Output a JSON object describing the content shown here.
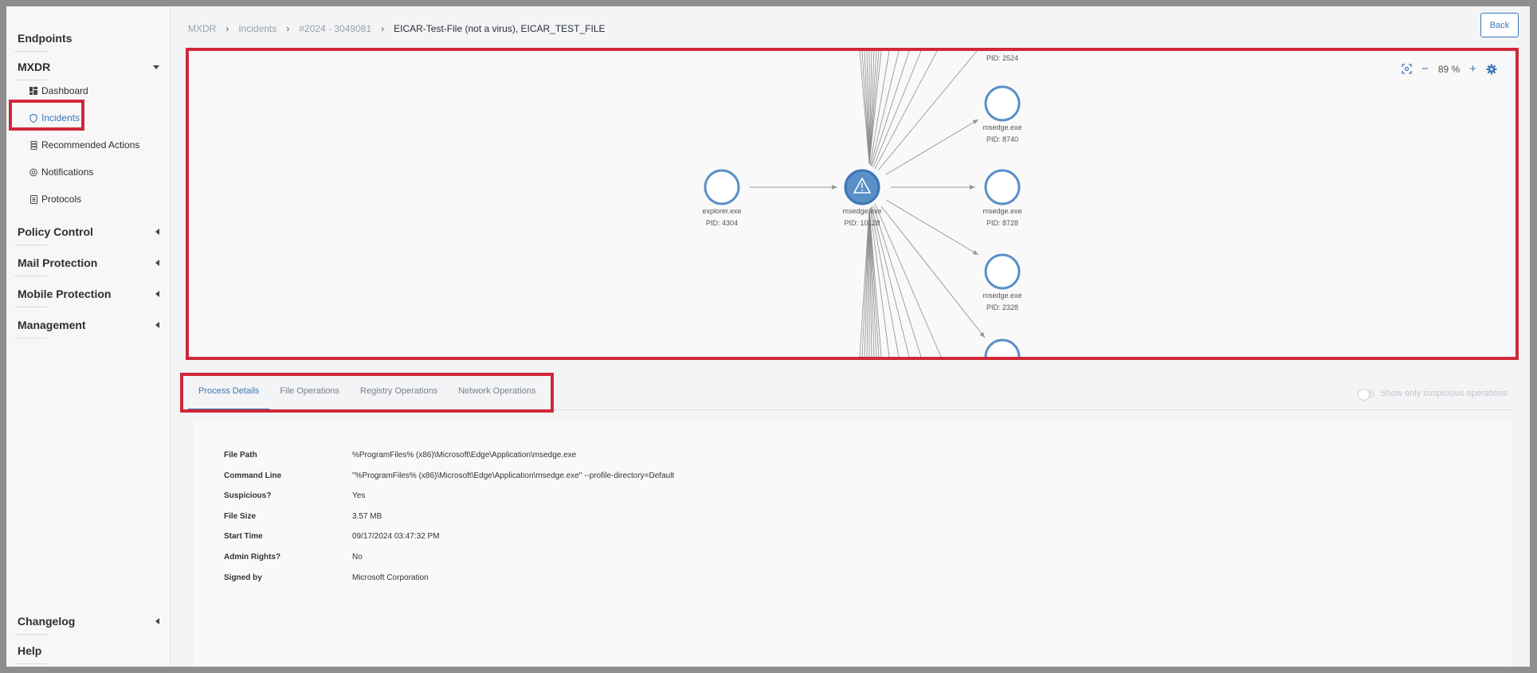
{
  "sidebar": {
    "endpoints": "Endpoints",
    "mxdr": "MXDR",
    "items": [
      {
        "label": "Dashboard",
        "icon": "dashboard-icon"
      },
      {
        "label": "Incidents",
        "icon": "shield-icon"
      },
      {
        "label": "Recommended Actions",
        "icon": "stack-icon"
      },
      {
        "label": "Notifications",
        "icon": "bell-circle-icon"
      },
      {
        "label": "Protocols",
        "icon": "document-icon"
      }
    ],
    "policy_control": "Policy Control",
    "mail_protection": "Mail Protection",
    "mobile_protection": "Mobile Protection",
    "management": "Management",
    "changelog": "Changelog",
    "help": "Help"
  },
  "breadcrumb": {
    "b1": "MXDR",
    "b2": "Incidents",
    "b3": "#2024 - 3049081",
    "current": "EICAR-Test-File (not a virus), EICAR_TEST_FILE"
  },
  "back_label": "Back",
  "graph": {
    "zoom": "89 %",
    "nodes": [
      {
        "name": "explorer.exe",
        "pid": "PID: 4304"
      },
      {
        "name": "msedge.exe",
        "pid": "PID: 10128",
        "suspicious": true
      },
      {
        "name": "msedge.exe",
        "pid": "PID: 8740"
      },
      {
        "name": "msedge.exe",
        "pid": "PID: 8728"
      },
      {
        "name": "msedge.exe",
        "pid": "PID: 2328"
      }
    ],
    "top_partial": "PID: 2524"
  },
  "tabs": [
    "Process Details",
    "File Operations",
    "Registry Operations",
    "Network Operations"
  ],
  "toggle_label": "Show only suspicious operations",
  "details": [
    {
      "label": "File Path",
      "value": "%ProgramFiles% (x86)\\Microsoft\\Edge\\Application\\msedge.exe"
    },
    {
      "label": "Command Line",
      "value": "\"%ProgramFiles% (x86)\\Microsoft\\Edge\\Application\\msedge.exe\" --profile-directory=Default"
    },
    {
      "label": "Suspicious?",
      "value": "Yes"
    },
    {
      "label": "File Size",
      "value": "3.57 MB"
    },
    {
      "label": "Start Time",
      "value": "09/17/2024 03:47:32 PM"
    },
    {
      "label": "Admin Rights?",
      "value": "No"
    },
    {
      "label": "Signed by",
      "value": "Microsoft Corporation"
    }
  ],
  "colors": {
    "accent": "#3d76b6",
    "highlight": "#d0283a",
    "node": "#5b8fc7"
  }
}
